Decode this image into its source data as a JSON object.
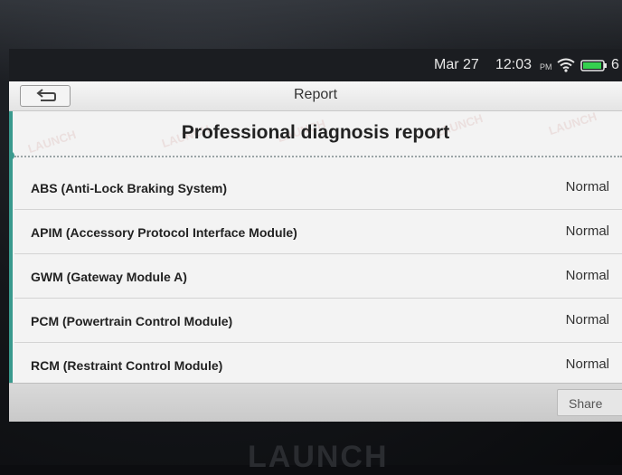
{
  "status_bar": {
    "date": "Mar 27",
    "time": "12:03",
    "ampm": "PM",
    "battery_percent": "6",
    "icons": [
      "wifi-icon",
      "battery-icon"
    ]
  },
  "header": {
    "title": "Report",
    "back_icon": "back-arrow-icon"
  },
  "report": {
    "heading": "Professional diagnosis report",
    "watermark": "LAUNCH",
    "rows": [
      {
        "name": "ABS (Anti-Lock Braking System)",
        "status": "Normal"
      },
      {
        "name": "APIM (Accessory Protocol Interface Module)",
        "status": "Normal"
      },
      {
        "name": "GWM (Gateway Module A)",
        "status": "Normal"
      },
      {
        "name": "PCM (Powertrain Control Module)",
        "status": "Normal"
      },
      {
        "name": "RCM (Restraint Control Module)",
        "status": "Normal"
      }
    ]
  },
  "footer": {
    "share_label": "Share"
  },
  "device": {
    "brand": "LAUNCH"
  },
  "colors": {
    "accent": "#3a9a8e",
    "screen_bg": "#f3f3f3",
    "statusbar_bg": "#1b1d21"
  }
}
